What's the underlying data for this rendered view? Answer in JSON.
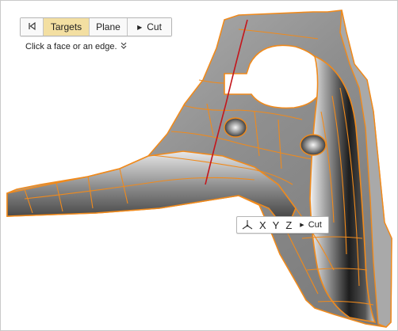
{
  "toolbar": {
    "back_icon": "step-back-icon",
    "targets_label": "Targets",
    "plane_label": "Plane",
    "cut_label": "Cut",
    "active_tab": "Targets",
    "active_color": "#f3dfa2"
  },
  "hint": {
    "text": "Click a face or an edge.",
    "expand_icon": "double-chevron-down-icon"
  },
  "axis_bar": {
    "triad_icon": "triad-icon",
    "x_label": "X",
    "y_label": "Y",
    "z_label": "Z",
    "cut_label": "Cut"
  },
  "model": {
    "edge_color": "#f08a1c",
    "section_line_color": "#c4161c",
    "surface_color": "#9a9a9a"
  }
}
